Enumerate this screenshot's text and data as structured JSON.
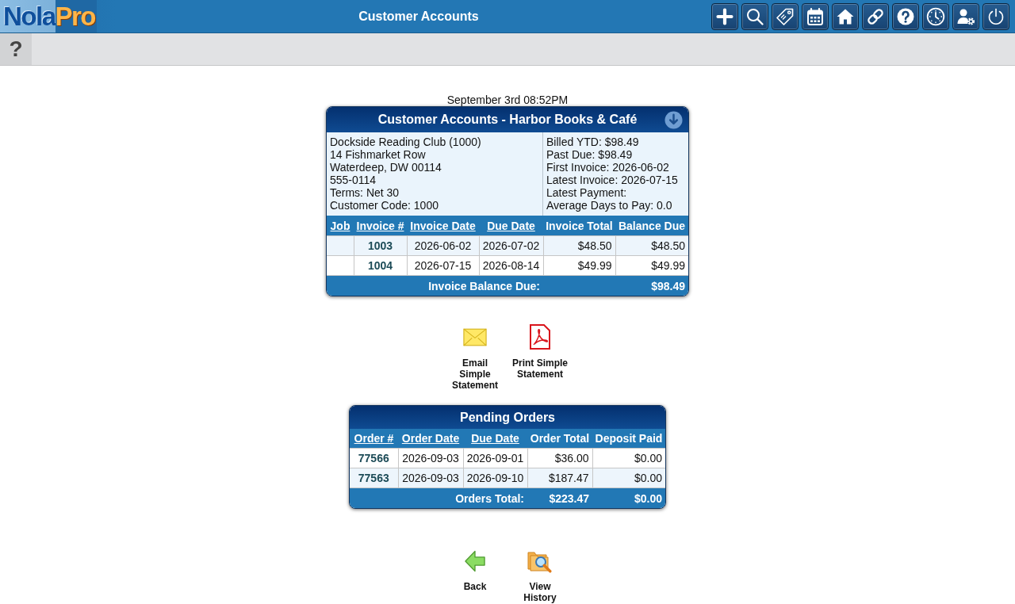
{
  "header": {
    "logo": {
      "first": "Nola",
      "second": "Pro"
    },
    "title": "Customer Accounts"
  },
  "subbar": {
    "help_button": "?"
  },
  "timestamp": "September 3rd 08:52PM",
  "account_card": {
    "title": "Customer Accounts - Harbor Books & Café",
    "contact_lines": [
      "Dockside Reading Club (1000)",
      "14 Fishmarket Row",
      "Waterdeep, DW 00114",
      "555-0114",
      "Terms: Net 30",
      "Customer Code: 1000"
    ],
    "summary_lines": [
      "Billed YTD: $98.49",
      "Past Due: $98.49",
      "First Invoice: 2026-06-02",
      "Latest Invoice: 2026-07-15",
      "Latest Payment:",
      "Average Days to Pay: 0.0"
    ],
    "columns": [
      {
        "label": "Job",
        "sortable": true
      },
      {
        "label": "Invoice #",
        "sortable": true
      },
      {
        "label": "Invoice Date",
        "sortable": true
      },
      {
        "label": "Due Date",
        "sortable": true
      },
      {
        "label": "Invoice Total",
        "sortable": false
      },
      {
        "label": "Balance Due",
        "sortable": false
      }
    ],
    "rows": [
      {
        "shaded": true,
        "invoice": "1003",
        "invoice_date": "2026-06-02",
        "due_date": "2026-07-02",
        "invoice_total": "$48.50",
        "balance_due": "$48.50"
      },
      {
        "shaded": false,
        "invoice": "1004",
        "invoice_date": "2026-07-15",
        "due_date": "2026-08-14",
        "invoice_total": "$49.99",
        "balance_due": "$49.99"
      }
    ],
    "footer": {
      "label": "Invoice Balance Due:",
      "balance_due": "$98.49"
    }
  },
  "statement_actions": [
    {
      "kind": "email",
      "label": "Email Simple Statement"
    },
    {
      "kind": "pdf",
      "label": "Print Simple Statement"
    }
  ],
  "pending_orders": {
    "title": "Pending Orders",
    "columns": [
      {
        "label": "Order #",
        "sortable": true
      },
      {
        "label": "Order Date",
        "sortable": true
      },
      {
        "label": "Due Date",
        "sortable": true
      },
      {
        "label": "Order Total",
        "sortable": false
      },
      {
        "label": "Deposit Paid",
        "sortable": false
      }
    ],
    "rows": [
      {
        "shaded": false,
        "order": "77566",
        "order_date": "2026-09-03",
        "due_date": "2026-09-01",
        "order_total": "$36.00",
        "deposit_paid": "$0.00"
      },
      {
        "shaded": true,
        "order": "77563",
        "order_date": "2026-09-03",
        "due_date": "2026-09-10",
        "order_total": "$187.47",
        "deposit_paid": "$0.00"
      }
    ],
    "footer": {
      "label": "Orders Total:",
      "order_total": "$223.47",
      "deposit_paid": "$0.00"
    }
  },
  "nav_actions": [
    {
      "kind": "back",
      "label": "Back"
    },
    {
      "kind": "history",
      "label": "View History"
    }
  ]
}
